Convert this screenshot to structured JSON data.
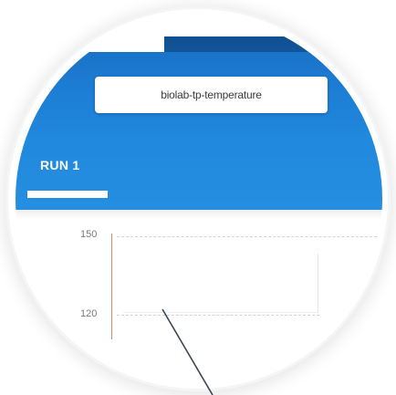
{
  "search": {
    "value": "biolab-tp-temperature"
  },
  "tabs": [
    {
      "label": "RUN 1",
      "active": true
    }
  ],
  "chart": {
    "y_ticks": [
      "150",
      "120"
    ]
  },
  "colors": {
    "appbar": "#1d7fd6",
    "tabbar": "#2189dd",
    "axis": "#c9896e",
    "callout_line": "#3c4754"
  }
}
